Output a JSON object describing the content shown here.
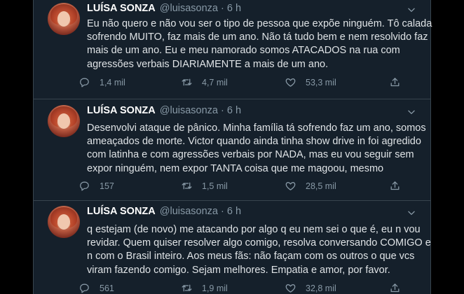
{
  "tweets": [
    {
      "name": "LUÍSA SONZA",
      "handle": "@luisasonza · 6 h",
      "lines": [
        "Eu não quero e não vou ser o tipo de pessoa que expõe ninguém. Tô calada",
        "sofrendo MUITO, faz mais de um ano. Não tá tudo bem e nem resolvido faz",
        "mais de um ano.  Eu e meu namorado somos ATACADOS na rua com",
        "agressões verbais DIARIAMENTE a mais de um ano."
      ],
      "replies": "1,4 mil",
      "retweets": "4,7 mil",
      "likes": "53,3 mil"
    },
    {
      "name": "LUÍSA SONZA",
      "handle": "@luisasonza · 6 h",
      "lines": [
        "Desenvolvi ataque de pânico. Minha família tá sofrendo faz um ano, somos",
        "ameaçados de morte. Victor quando ainda tinha show drive in foi agredido",
        "com latinha e com agressões verbais por NADA, mas eu vou seguir sem",
        "expor ninguém, nem expor TANTA coisa que me magoou, mesmo"
      ],
      "replies": "157",
      "retweets": "1,5 mil",
      "likes": "28,5 mil"
    },
    {
      "name": "LUÍSA SONZA",
      "handle": "@luisasonza · 6 h",
      "lines": [
        "q estejam (de novo) me atacando por algo q eu nem sei o que é, eu n vou",
        "revidar. Quem quiser resolver algo comigo, resolva conversando COMIGO e",
        "n com o Brasil inteiro. Aos meus fãs: não façam com os outros o que vcs",
        "viram fazendo comigo. Sejam melhores. Empatia e amor, por favor."
      ],
      "replies": "561",
      "retweets": "1,9 mil",
      "likes": "32,8 mil"
    }
  ],
  "icons": {
    "reply": "reply-icon",
    "retweet": "retweet-icon",
    "like": "like-icon",
    "share": "share-icon",
    "more": "chevron-down-icon"
  },
  "colors": {
    "background": "#15202b",
    "outer": "#000000",
    "secondary_text": "#8899a6",
    "border": "#38444d"
  }
}
